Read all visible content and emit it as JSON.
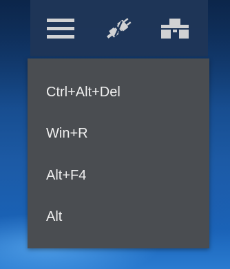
{
  "toolbar": {
    "icons": [
      "menu-icon",
      "disconnect-plug-icon",
      "display-screens-icon"
    ]
  },
  "menu": {
    "items": [
      {
        "label": "Ctrl+Alt+Del"
      },
      {
        "label": "Win+R"
      },
      {
        "label": "Alt+F4"
      },
      {
        "label": "Alt"
      }
    ]
  },
  "colors": {
    "toolbar_bg": "#1f3658",
    "menu_bg": "#4a4d51",
    "menu_text": "#f0f0f0",
    "icon": "#d8d8d8"
  }
}
